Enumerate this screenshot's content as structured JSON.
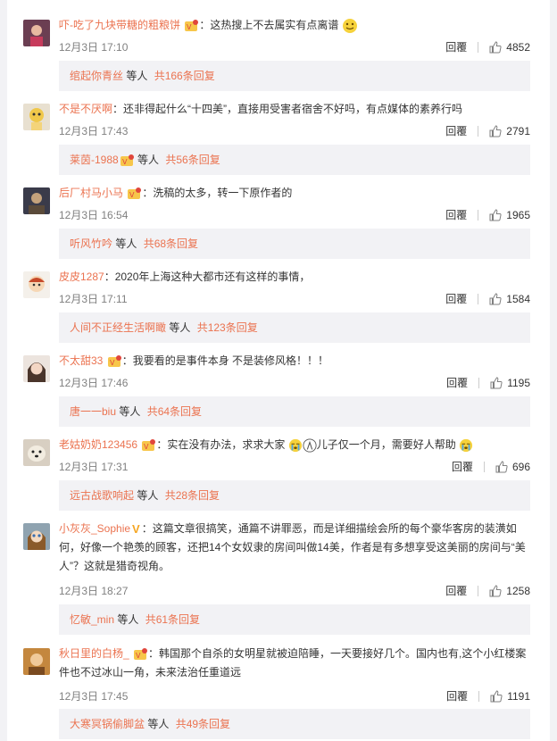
{
  "comments": [
    {
      "user": "吓-吃了九块带糖的粗粮饼",
      "text": "：这热搜上不去属实有点离谱",
      "time": "12月3日 17:10",
      "reply": "回覆",
      "likes": "4852",
      "sub_user": "绾起你青丝",
      "sub_mid": " 等人 ",
      "sub_total": "共166条回复"
    },
    {
      "user": "不是不厌啊",
      "text": "：还非得起什么“十四美”，直接用受害者宿舍不好吗，有点媒体的素养行吗",
      "time": "12月3日 17:43",
      "reply": "回覆",
      "likes": "2791",
      "sub_user": "莱茵-1988",
      "sub_mid": " 等人 ",
      "sub_total": "共56条回复"
    },
    {
      "user": "后厂村马小马",
      "text": "：洗稿的太多，转一下原作者的",
      "time": "12月3日 16:54",
      "reply": "回覆",
      "likes": "1965",
      "sub_user": "听风竹吟",
      "sub_mid": " 等人 ",
      "sub_total": "共68条回复"
    },
    {
      "user": "皮皮1287",
      "text": "：2020年上海这种大都市还有这样的事情，",
      "time": "12月3日 17:11",
      "reply": "回覆",
      "likes": "1584",
      "sub_user": "人间不正经生活啊瞰",
      "sub_mid": " 等人 ",
      "sub_total": "共123条回复"
    },
    {
      "user": "不太甜33",
      "text": "：我要看的是事件本身 不是装修风格！！！",
      "time": "12月3日 17:46",
      "reply": "回覆",
      "likes": "1195",
      "sub_user": "唐一一biu",
      "sub_mid": " 等人 ",
      "sub_total": "共64条回复"
    },
    {
      "user": "老姑奶奶123456",
      "text1": "：实在没有办法，求求大家",
      "text2": "儿子仅一个月，需要好人帮助",
      "time": "12月3日 17:31",
      "reply": "回覆",
      "likes": "696",
      "sub_user": "远古战歌响起",
      "sub_mid": " 等人 ",
      "sub_total": "共28条回复"
    },
    {
      "user": "小灰灰_Sophie",
      "v": "V",
      "text": "：这篇文章很搞笑，通篇不讲罪恶，而是详细描绘会所的每个豪华客房的装潢如何，好像一个艳羡的顾客，还把14个女奴隶的房间叫做14美，作者是有多想享受这美丽的房间与“美人”？这就是猎奇视角。",
      "time": "12月3日 18:27",
      "reply": "回覆",
      "likes": "1258",
      "sub_user": "忆敏_min",
      "sub_mid": " 等人 ",
      "sub_total": "共61条回复"
    },
    {
      "user": "秋日里的白杨_",
      "text": "：韩国那个自杀的女明星就被迫陪睡，一天要接好几个。国内也有,这个小红楼案件也不过冰山一角，未来法治任重道远",
      "time": "12月3日 17:45",
      "reply": "回覆",
      "likes": "1191",
      "sub_user": "大寒冥锅偷脚盆",
      "sub_mid": " 等人 ",
      "sub_total": "共49条回复"
    }
  ],
  "colors": {
    "link": "#eb7350",
    "text": "#333333",
    "meta": "#808080",
    "subbox": "#f2f2f5"
  },
  "icons": {
    "like": "thumbs-up-icon",
    "member": "vip-member-icon",
    "emoji": "smile-emoji-icon"
  }
}
